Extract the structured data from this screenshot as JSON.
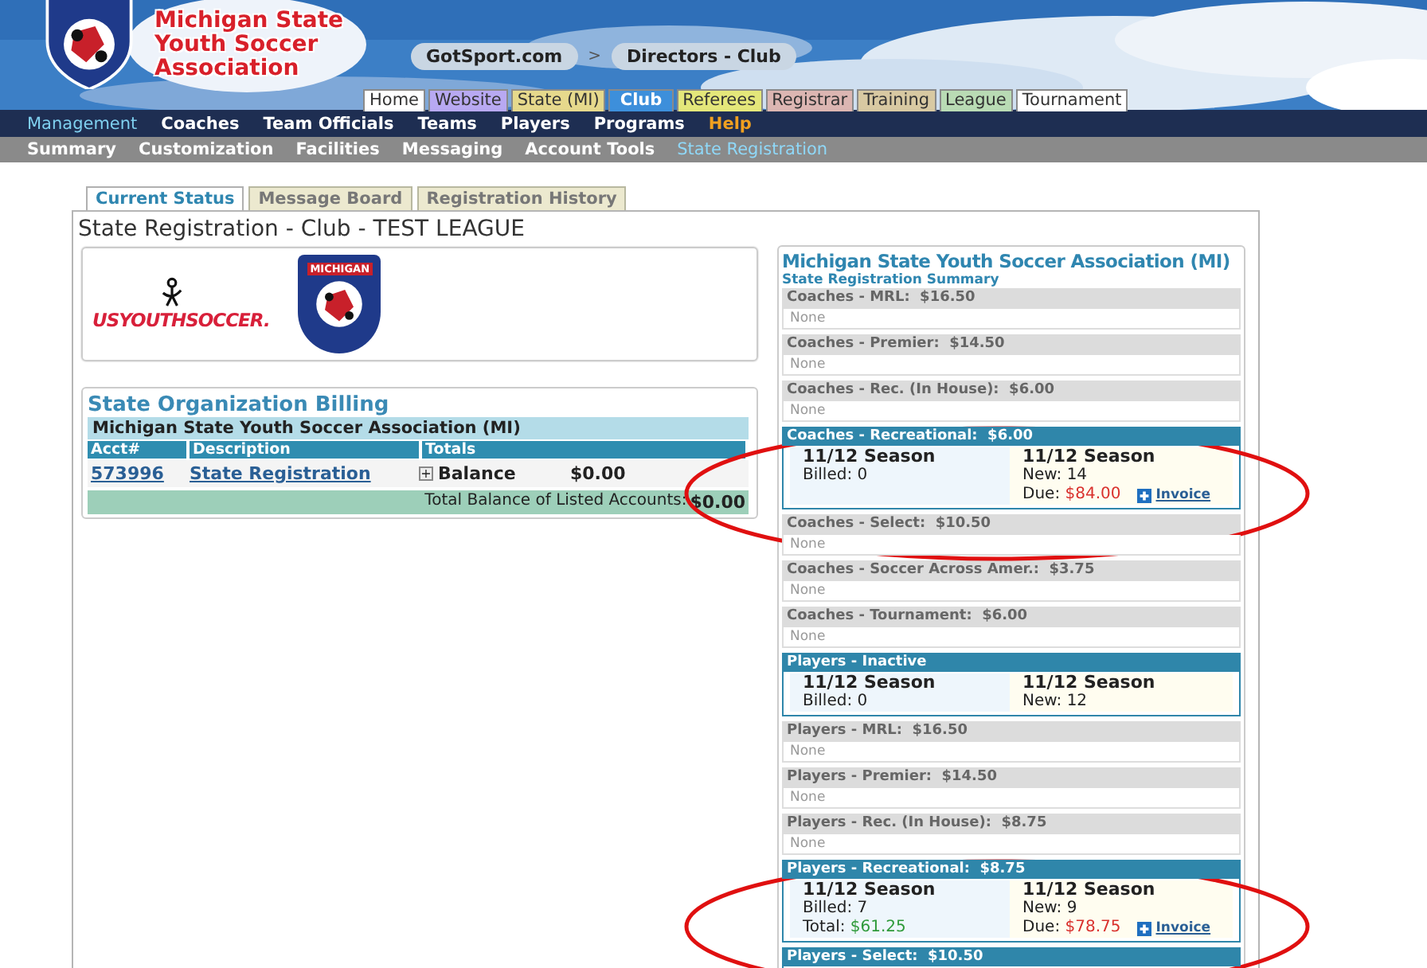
{
  "banner": {
    "title_lines": [
      "Michigan State",
      "Youth Soccer",
      "Association"
    ],
    "breadcrumb": [
      "GotSport.com",
      ">",
      "Directors - Club"
    ]
  },
  "top_tabs": [
    {
      "label": "Home",
      "color": "#ffffff",
      "selected": false
    },
    {
      "label": "Website",
      "color": "#b8a9f2",
      "selected": false
    },
    {
      "label": "State (MI)",
      "color": "#e6d98c",
      "selected": false
    },
    {
      "label": "Club",
      "color": "#3d8fdb",
      "selected": true
    },
    {
      "label": "Referees",
      "color": "#e4e77a",
      "selected": false
    },
    {
      "label": "Registrar",
      "color": "#dcb6b2",
      "selected": false
    },
    {
      "label": "Training",
      "color": "#d8c9a2",
      "selected": false
    },
    {
      "label": "League",
      "color": "#b9dbb4",
      "selected": false
    },
    {
      "label": "Tournament",
      "color": "#ffffff",
      "selected": false
    }
  ],
  "main_menu": [
    {
      "label": "Management",
      "selected": true,
      "kind": "normal"
    },
    {
      "label": "Coaches",
      "selected": false,
      "kind": "normal"
    },
    {
      "label": "Team Officials",
      "selected": false,
      "kind": "normal"
    },
    {
      "label": "Teams",
      "selected": false,
      "kind": "normal"
    },
    {
      "label": "Players",
      "selected": false,
      "kind": "normal"
    },
    {
      "label": "Programs",
      "selected": false,
      "kind": "normal"
    },
    {
      "label": "Help",
      "selected": false,
      "kind": "help"
    }
  ],
  "sub_menu": [
    {
      "label": "Summary",
      "selected": false
    },
    {
      "label": "Customization",
      "selected": false
    },
    {
      "label": "Facilities",
      "selected": false
    },
    {
      "label": "Messaging",
      "selected": false
    },
    {
      "label": "Account Tools",
      "selected": false
    },
    {
      "label": "State Registration",
      "selected": true
    }
  ],
  "page_tabs": [
    {
      "label": "Current Status",
      "selected": true
    },
    {
      "label": "Message Board",
      "selected": false
    },
    {
      "label": "Registration History",
      "selected": false
    }
  ],
  "page_title": "State Registration - Club - TEST LEAGUE",
  "logos": {
    "usys": "USYOUTHSOCCER.",
    "michigan": "MICHIGAN"
  },
  "billing": {
    "title": "State Organization Billing",
    "org": "Michigan State Youth Soccer Association (MI)",
    "columns": [
      "Acct#",
      "Description",
      "Totals"
    ],
    "rows": [
      {
        "acct": "573996",
        "description": "State Registration",
        "expand": "+",
        "label": "Balance",
        "amount": "$0.00"
      }
    ],
    "total_label": "Total Balance of Listed Accounts:",
    "total_amount": "$0.00"
  },
  "summary": {
    "title": "Michigan State Youth Soccer Association (MI)",
    "subtitle": "State Registration Summary",
    "sections": [
      {
        "kind": "empty",
        "header": "Coaches - MRL:  $16.50",
        "note": "None"
      },
      {
        "kind": "empty",
        "header": "Coaches - Premier:  $14.50",
        "note": "None"
      },
      {
        "kind": "empty",
        "header": "Coaches - Rec. (In House):  $6.00",
        "note": "None"
      },
      {
        "kind": "detail",
        "circled": true,
        "header": "Coaches - Recreational:  $6.00",
        "left": {
          "season": "11/12 Season",
          "lines": [
            {
              "label": "Billed:",
              "value": "0"
            }
          ]
        },
        "right": {
          "season": "11/12 Season",
          "lines": [
            {
              "label": "New:",
              "value": "14"
            },
            {
              "label": "Due:",
              "value": "$84.00",
              "color": "#d9302c"
            }
          ],
          "invoice": "Invoice"
        }
      },
      {
        "kind": "empty",
        "header": "Coaches - Select:  $10.50",
        "note": "None"
      },
      {
        "kind": "empty",
        "header": "Coaches - Soccer Across Amer.:  $3.75",
        "note": "None"
      },
      {
        "kind": "empty",
        "header": "Coaches - Tournament:  $6.00",
        "note": "None"
      },
      {
        "kind": "detail",
        "circled": false,
        "header": "Players - Inactive",
        "left": {
          "season": "11/12 Season",
          "lines": [
            {
              "label": "Billed:",
              "value": "0"
            }
          ]
        },
        "right": {
          "season": "11/12 Season",
          "lines": [
            {
              "label": "New:",
              "value": "12"
            }
          ]
        }
      },
      {
        "kind": "empty",
        "header": "Players - MRL:  $16.50",
        "note": "None"
      },
      {
        "kind": "empty",
        "header": "Players - Premier:  $14.50",
        "note": "None"
      },
      {
        "kind": "empty",
        "header": "Players - Rec. (In House):  $8.75",
        "note": "None"
      },
      {
        "kind": "detail",
        "circled": true,
        "header": "Players - Recreational:  $8.75",
        "left": {
          "season": "11/12 Season",
          "lines": [
            {
              "label": "Billed:",
              "value": "7"
            },
            {
              "label": "Total:",
              "value": "$61.25",
              "color": "#2f9a3a"
            }
          ]
        },
        "right": {
          "season": "11/12 Season",
          "lines": [
            {
              "label": "New:",
              "value": "9"
            },
            {
              "label": "Due:",
              "value": "$78.75",
              "color": "#d9302c"
            }
          ],
          "invoice": "Invoice"
        }
      },
      {
        "kind": "cut",
        "circled": false,
        "header": "Players - Select:  $10.50"
      }
    ]
  }
}
